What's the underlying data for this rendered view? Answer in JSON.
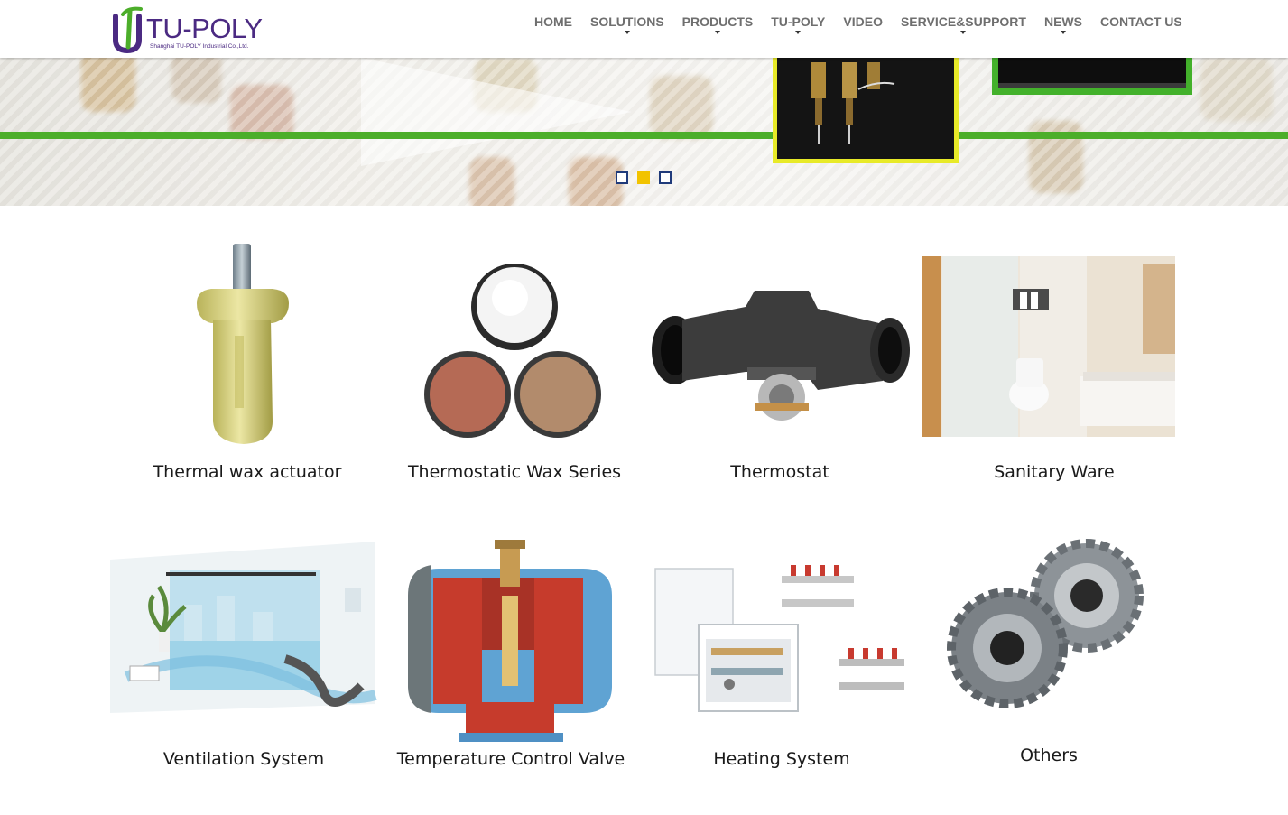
{
  "brand": {
    "name": "TU-POLY",
    "tagline": "Shanghai TU-POLY Industrial Co.,Ltd.",
    "colors": {
      "purple": "#4b2a82",
      "green": "#4cae2a",
      "accent_yellow": "#f2c300"
    }
  },
  "nav": {
    "items": [
      {
        "label": "HOME",
        "dropdown": false
      },
      {
        "label": "SOLUTIONS",
        "dropdown": true
      },
      {
        "label": "PRODUCTS",
        "dropdown": true
      },
      {
        "label": "TU-POLY",
        "dropdown": true
      },
      {
        "label": "VIDEO",
        "dropdown": false
      },
      {
        "label": "SERVICE&SUPPORT",
        "dropdown": true
      },
      {
        "label": "NEWS",
        "dropdown": true
      },
      {
        "label": "CONTACT US",
        "dropdown": false
      }
    ]
  },
  "slider": {
    "slide_count": 3,
    "active_index": 1
  },
  "products": [
    {
      "label": "Thermal wax actuator",
      "icon": "wax-actuator-image"
    },
    {
      "label": "Thermostatic Wax Series",
      "icon": "wax-powder-image"
    },
    {
      "label": "Thermostat",
      "icon": "thermostat-image"
    },
    {
      "label": "Sanitary Ware",
      "icon": "bathroom-image"
    },
    {
      "label": "Ventilation System",
      "icon": "ventilation-image"
    },
    {
      "label": "Temperature Control Valve",
      "icon": "valve-image"
    },
    {
      "label": "Heating System",
      "icon": "manifold-image"
    },
    {
      "label": "Others",
      "icon": "gears-image"
    }
  ]
}
